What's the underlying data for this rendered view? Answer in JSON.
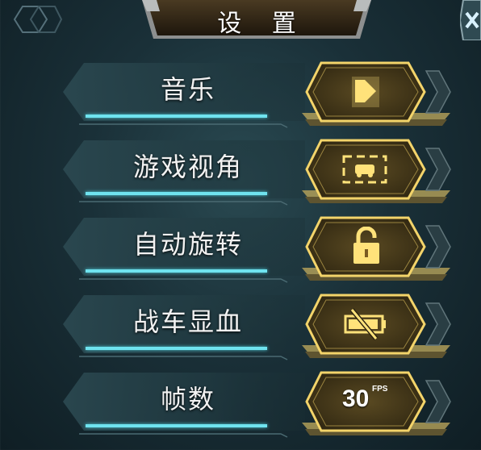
{
  "title": "设 置",
  "settings": [
    {
      "label": "音乐",
      "icon": "speaker-icon"
    },
    {
      "label": "游戏视角",
      "icon": "camera-view-icon"
    },
    {
      "label": "自动旋转",
      "icon": "unlock-icon"
    },
    {
      "label": "战车显血",
      "icon": "health-bar-off-icon"
    },
    {
      "label": "帧数",
      "icon": "fps-icon",
      "value": "30",
      "unit": "FPS"
    }
  ],
  "colors": {
    "accent_cyan": "#6fe3ef",
    "button_gold": "#f3d46a",
    "title_bg": "#3a2a14"
  }
}
